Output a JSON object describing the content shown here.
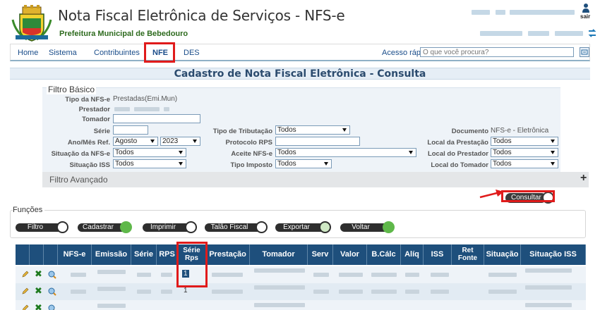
{
  "header": {
    "title": "Nota Fiscal Eletrônica de Serviços - NFS-e",
    "org": "Prefeitura Municipal de Bebedouro",
    "exit_label": "sair"
  },
  "nav": {
    "items": [
      {
        "label": "Home"
      },
      {
        "label": "Sistema"
      },
      {
        "label": "Contribuintes"
      },
      {
        "label": "NFE"
      },
      {
        "label": "DES"
      }
    ],
    "quick_access_label": "Acesso rápido:",
    "quick_access_placeholder": "O que você procura?"
  },
  "page_title": "Cadastro de Nota Fiscal Eletrônica - Consulta",
  "filter": {
    "title": "Filtro Básico",
    "tipo_nfse_label": "Tipo da NFS-e",
    "tipo_nfse_value": "Prestadas(Emi.Mun)",
    "prestador_label": "Prestador",
    "tomador_label": "Tomador",
    "serie_label": "Série",
    "ano_mes_label": "Ano/Mês Ref.",
    "mes_value": "Agosto",
    "ano_value": "2023",
    "situacao_nfse_label": "Situação da NFS-e",
    "situacao_nfse_value": "Todos",
    "situacao_iss_label": "Situação ISS",
    "situacao_iss_value": "Todos",
    "tipo_tributacao_label": "Tipo de Tributação",
    "tipo_tributacao_value": "Todos",
    "protocolo_rps_label": "Protocolo RPS",
    "aceite_nfse_label": "Aceite NFS-e",
    "aceite_nfse_value": "Todos",
    "tipo_imposto_label": "Tipo Imposto",
    "tipo_imposto_value": "Todos",
    "documento_label": "Documento",
    "documento_value": "NFS-e - Eletrônica",
    "local_prestacao_label": "Local da Prestação",
    "local_prestacao_value": "Todos",
    "local_prestador_label": "Local do Prestador",
    "local_prestador_value": "Todos",
    "local_tomador_label": "Local do Tomador",
    "local_tomador_value": "Todos",
    "advanced_label": "Filtro Avançado",
    "advanced_toggle": "+",
    "consult_label": "Consultar"
  },
  "functions": {
    "title": "Funções",
    "buttons": [
      {
        "label": "Filtro"
      },
      {
        "label": "Cadastrar"
      },
      {
        "label": "Imprimir"
      },
      {
        "label": "Talão Fiscal"
      },
      {
        "label": "Exportar"
      },
      {
        "label": "Voltar"
      }
    ]
  },
  "table": {
    "columns": [
      "NFS-e",
      "Emissão",
      "Série",
      "RPS",
      "Série Rps",
      "Prestação",
      "Tomador",
      "Serv",
      "Valor",
      "B.Cálc",
      "Alíq",
      "ISS",
      "Ret Fonte",
      "Situação",
      "Situação ISS"
    ],
    "serie_rps_values": [
      "1",
      "1"
    ]
  },
  "colors": {
    "header_green": "#2e6b1e",
    "nav_blue": "#1a4d8a",
    "table_header": "#1e4f7c",
    "highlight_red": "#e01b1b"
  }
}
